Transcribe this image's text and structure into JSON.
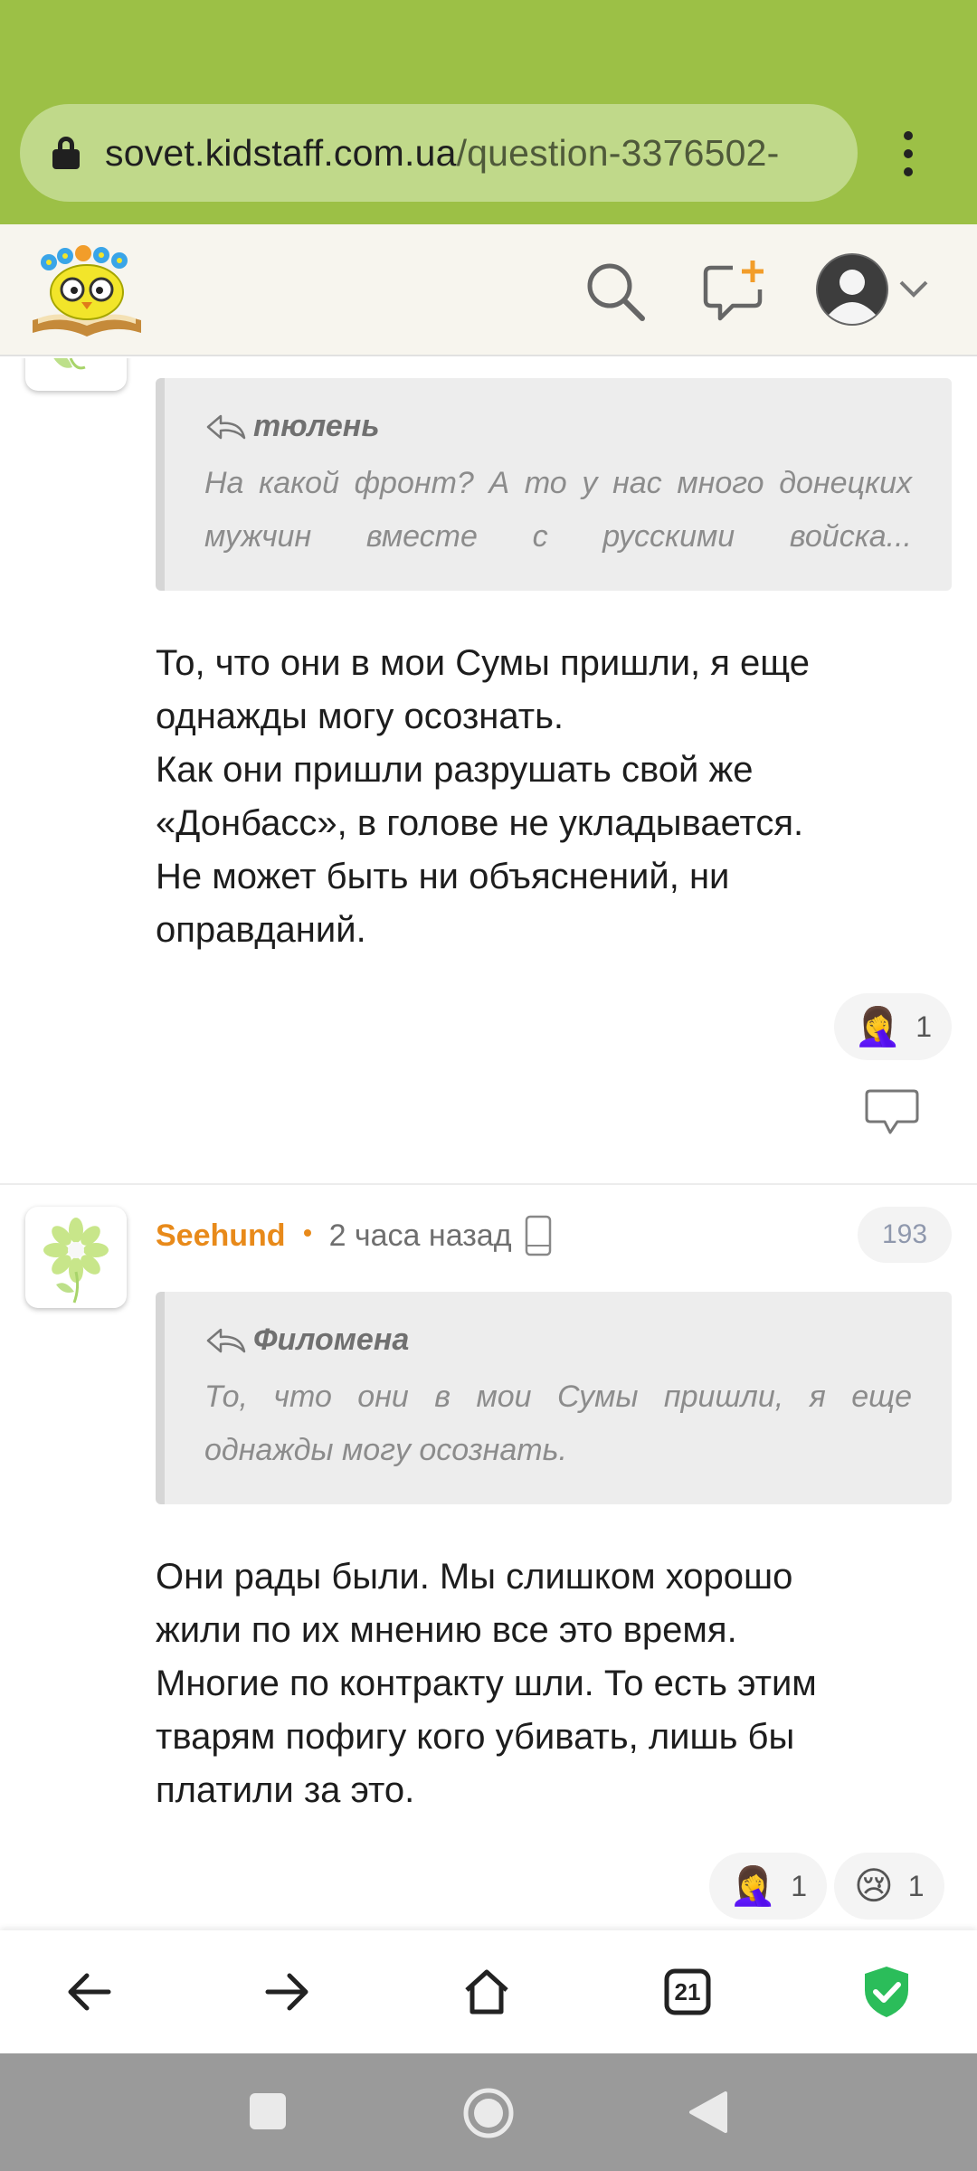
{
  "browser": {
    "url_domain": "sovet.kidstaff.com.ua",
    "url_path": "/question-3376502-",
    "lock_icon": "lock-icon",
    "menu_icon": "kebab-menu-icon"
  },
  "header": {
    "logo": "kidstaff-owl-logo",
    "search_icon": "search-icon",
    "new_question_icon": "new-message-icon",
    "profile_icon": "user-avatar-icon"
  },
  "comments": [
    {
      "quote_author": "тюлень",
      "quote_line1": "На какой фронт? А то у нас много донецких",
      "quote_line2": "мужчин вместе с русскими войска...",
      "body": [
        "То, что они в мои Сумы пришли, я еще",
        "однажды могу осознать.",
        "Как они пришли разрушать свой же",
        "«Донбасс», в голове не укладывается.",
        "Не может быть ни объяснений, ни",
        "оправданий."
      ],
      "reactions": [
        {
          "emoji": "🤦‍♀️",
          "count": "1"
        }
      ]
    },
    {
      "author": "Seehund",
      "time": "2 часа назад",
      "count": "193",
      "quote_author": "Филомена",
      "quote_line1": "То, что они в мои Сумы пришли, я еще",
      "quote_line2": "однажды могу осознать.",
      "body": [
        "Они рады были. Мы слишком хорошо",
        "жили по их мнению все это время.",
        "Многие по контракту шли. То есть этим",
        "тварям пофигу кого убивать, лишь бы",
        "платили за это."
      ],
      "reactions": [
        {
          "emoji": "🤦‍♀️",
          "count": "1"
        },
        {
          "emoji": "😢",
          "count": "1"
        }
      ]
    }
  ],
  "bottom_nav": {
    "tab_count": "21"
  },
  "colors": {
    "browser_green": "#9cc046",
    "author_orange": "#e88a1a",
    "shield_green": "#2bbd5a"
  }
}
